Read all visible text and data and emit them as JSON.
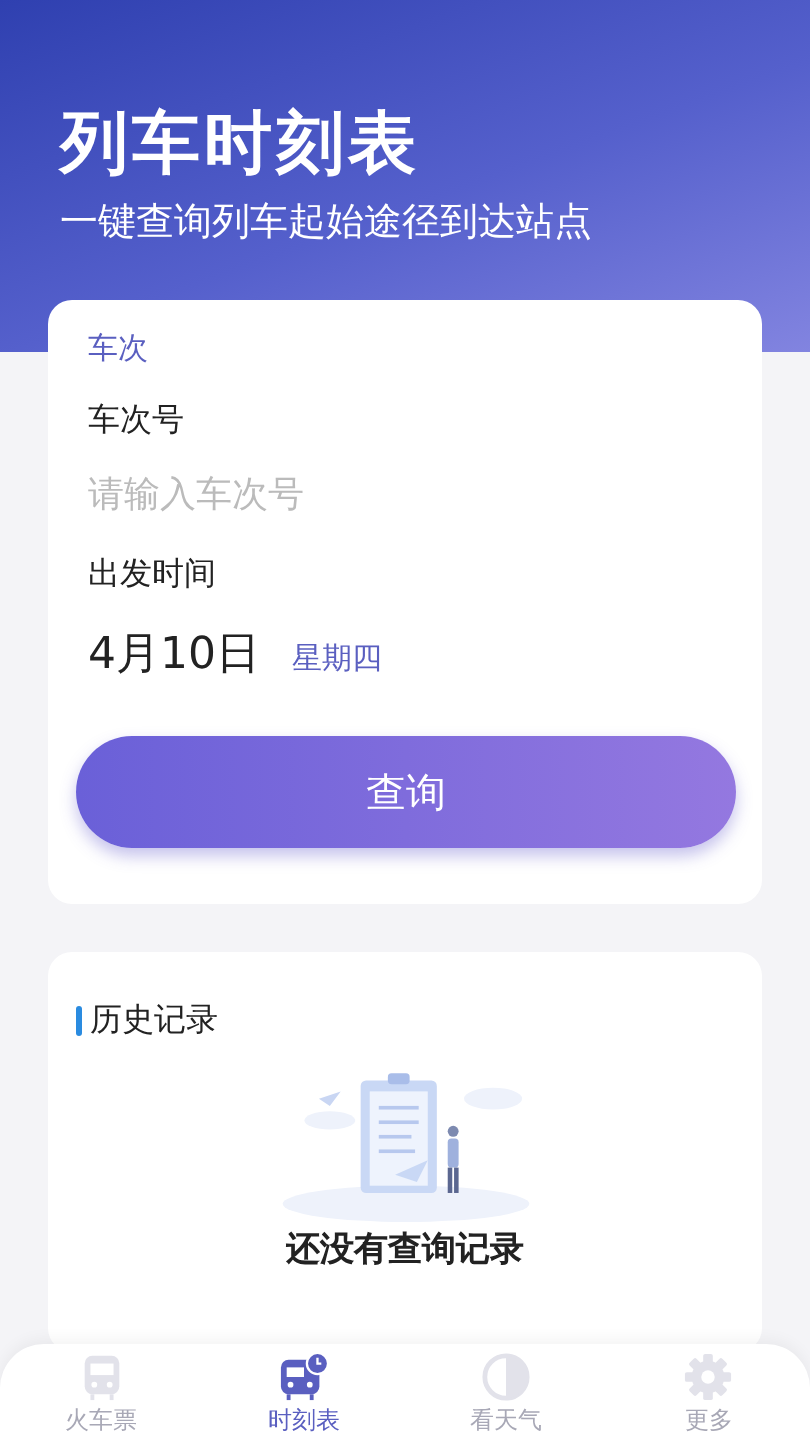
{
  "header": {
    "title": "列车时刻表",
    "subtitle": "一键查询列车起始途径到达站点"
  },
  "query_card": {
    "section_label": "车次",
    "train_field": {
      "label": "车次号",
      "placeholder": "请输入车次号"
    },
    "date_field": {
      "label": "出发时间",
      "date": "4月10日",
      "weekday": "星期四"
    },
    "button": "查询"
  },
  "history": {
    "title": "历史记录",
    "empty_text": "还没有查询记录"
  },
  "tabs": [
    {
      "label": "火车票",
      "kind": "train",
      "selected": false
    },
    {
      "label": "时刻表",
      "kind": "timetable",
      "selected": true
    },
    {
      "label": "看天气",
      "kind": "weather",
      "selected": false
    },
    {
      "label": "更多",
      "kind": "more",
      "selected": false
    }
  ]
}
